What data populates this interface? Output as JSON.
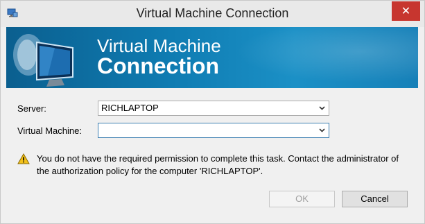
{
  "window": {
    "title": "Virtual Machine Connection",
    "close_glyph": "✕"
  },
  "banner": {
    "title_line1": "Virtual Machine",
    "title_line2": "Connection"
  },
  "form": {
    "server_label": "Server:",
    "server_value": "RICHLAPTOP",
    "vm_label": "Virtual Machine:",
    "vm_value": ""
  },
  "warning": {
    "icon": "warning-icon",
    "message": "You do not have the required permission to complete this task. Contact the administrator of the authorization policy for the computer 'RICHLAPTOP'."
  },
  "buttons": {
    "ok_label": "OK",
    "ok_enabled": false,
    "cancel_label": "Cancel"
  },
  "colors": {
    "banner": "#0f7cb2",
    "close": "#c7362f"
  }
}
